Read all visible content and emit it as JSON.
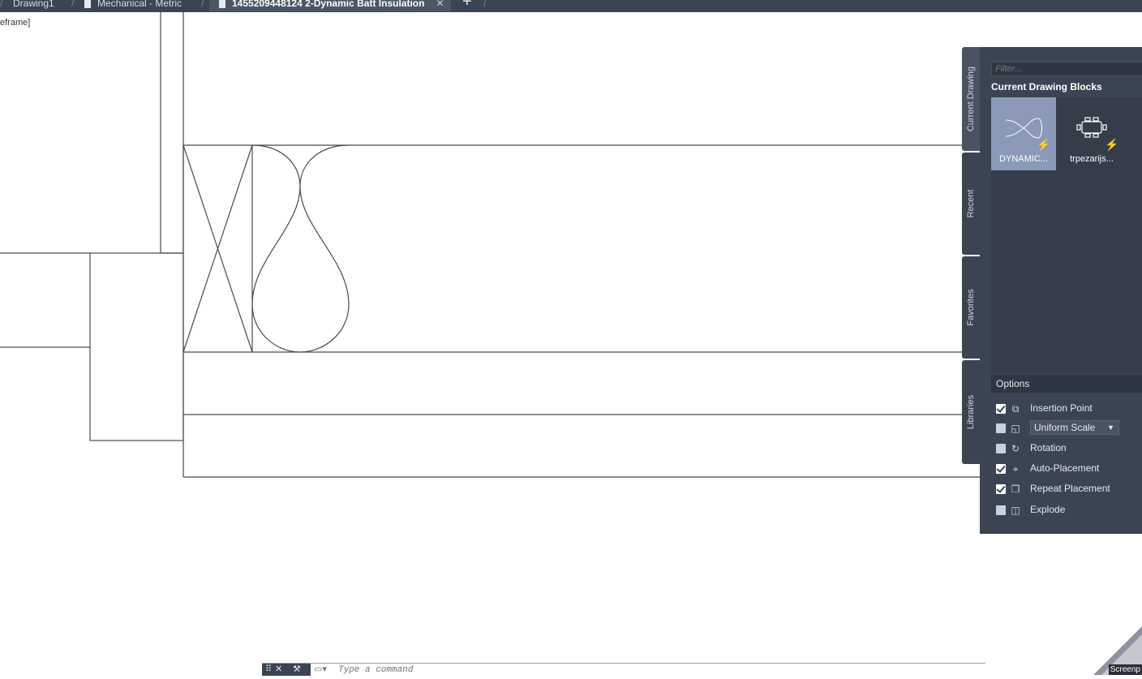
{
  "tabs": [
    {
      "label": "Drawing1"
    },
    {
      "label": "Mechanical - Metric"
    },
    {
      "label": "1455209448124 2-Dynamic Batt Insulation",
      "active": true
    }
  ],
  "viewport_label": "eframe]",
  "palette": {
    "side_tabs": [
      "Current Drawing",
      "Recent",
      "Favorites",
      "Libraries"
    ],
    "filter_placeholder": "Filter...",
    "blocks_title": "Current Drawing Blocks",
    "blocks": [
      {
        "name": "DYNAMIC...",
        "selected": true
      },
      {
        "name": "trpezarijs...",
        "selected": false
      }
    ],
    "options_title": "Options",
    "options": {
      "insertion_point": {
        "label": "Insertion Point",
        "checked": true
      },
      "uniform_scale": {
        "label": "Uniform Scale",
        "checked": false
      },
      "rotation": {
        "label": "Rotation",
        "checked": false
      },
      "auto_placement": {
        "label": "Auto-Placement",
        "checked": true
      },
      "repeat_placement": {
        "label": "Repeat Placement",
        "checked": true
      },
      "explode": {
        "label": "Explode",
        "checked": false
      }
    }
  },
  "command": {
    "placeholder": "Type a command"
  },
  "corner_badge": "Screenp",
  "colors": {
    "panel_bg": "#3b4453",
    "accent_bolt": "#f5c232",
    "selected_tile": "#8a9ab8"
  }
}
